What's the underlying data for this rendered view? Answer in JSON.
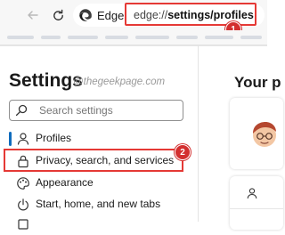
{
  "browser": {
    "app_name": "Edge",
    "url_scheme": "edge://",
    "url_path": "settings/profiles",
    "step1_badge": "1"
  },
  "sidebar": {
    "title": "Settings",
    "watermark": "@thegeekpage.com",
    "search_placeholder": "Search settings",
    "items": [
      {
        "label": "Profiles",
        "icon": "profile-icon",
        "active": true
      },
      {
        "label": "Privacy, search, and services",
        "icon": "lock-icon"
      },
      {
        "label": "Appearance",
        "icon": "palette-icon"
      },
      {
        "label": "Start, home, and new tabs",
        "icon": "power-icon"
      }
    ],
    "step2_badge": "2"
  },
  "main": {
    "title": "Your p"
  },
  "colors": {
    "highlight": "#e53935",
    "badge": "#d32f2f",
    "accent": "#0f6cbd"
  }
}
